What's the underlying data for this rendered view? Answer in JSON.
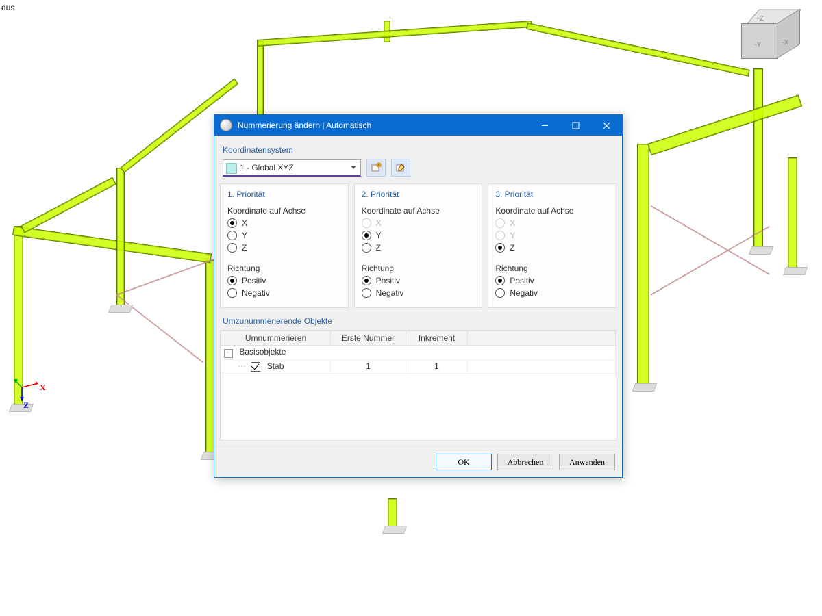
{
  "tinyLabel": "dus",
  "axes": {
    "x": "X",
    "z": "Z"
  },
  "navcube": {
    "yp": "+Z",
    "xm": "-X",
    "zp": "-Y"
  },
  "dialog": {
    "title": "Nummerierung ändern | Automatisch",
    "sections": {
      "coord": "Koordinatensystem",
      "objects": "Umzunummerierende Objekte"
    },
    "coordSelect": "1 - Global XYZ",
    "priority": {
      "labels": {
        "p1": "1. Priorität",
        "p2": "2. Priorität",
        "p3": "3. Priorität"
      },
      "axisLabel": "Koordinate auf Achse",
      "dirLabel": "Richtung",
      "axes": {
        "x": "X",
        "y": "Y",
        "z": "Z"
      },
      "dir": {
        "pos": "Positiv",
        "neg": "Negativ"
      },
      "p1": {
        "axis": "x",
        "dir": "pos",
        "disabled": []
      },
      "p2": {
        "axis": "y",
        "dir": "pos",
        "disabled": [
          "x"
        ]
      },
      "p3": {
        "axis": "z",
        "dir": "pos",
        "disabled": [
          "x",
          "y"
        ]
      }
    },
    "table": {
      "headers": {
        "renum": "Umnummerieren",
        "first": "Erste Nummer",
        "inc": "Inkrement"
      },
      "group": "Basisobjekte",
      "rows": [
        {
          "label": "Stab",
          "checked": true,
          "first": 1,
          "inc": 1
        }
      ]
    },
    "buttons": {
      "ok": "OK",
      "cancel": "Abbrechen",
      "apply": "Anwenden"
    }
  }
}
